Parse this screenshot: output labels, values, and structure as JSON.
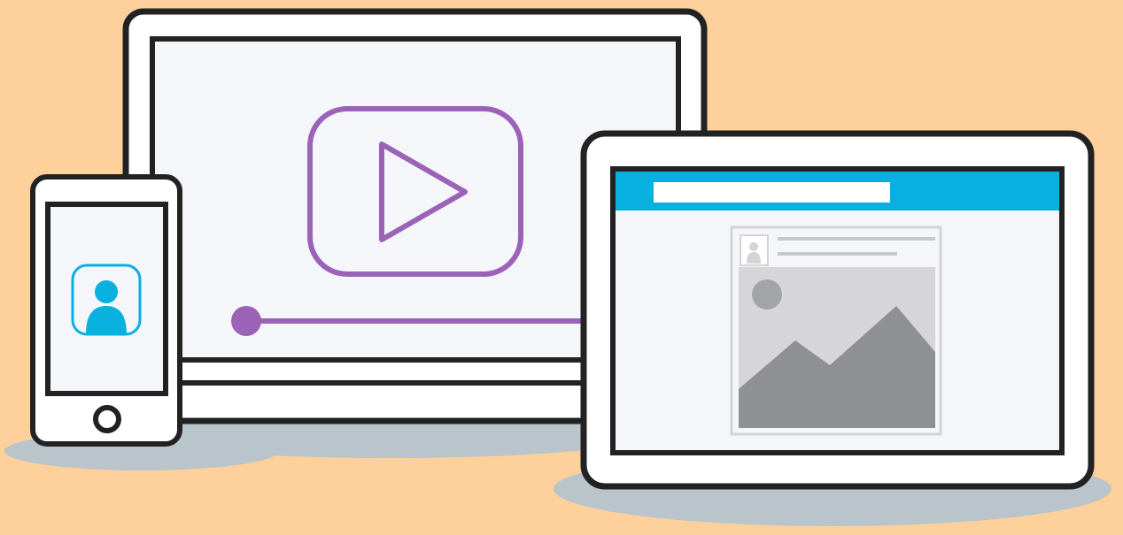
{
  "colors": {
    "background": "#FDD09C",
    "shadow": "#B9C4CB",
    "device_outline": "#222222",
    "device_body": "#FFFFFF",
    "screen": "#F4F6FA",
    "video_accent": "#9B63B8",
    "profile_accent": "#08B0E0",
    "header_bar": "#08B0E0",
    "card_border": "#D4D4D6",
    "card_fill": "#E6E6E8",
    "image_placeholder": "#D6D6D8",
    "mountain": "#8F9092",
    "sun": "#A3A4A6",
    "text_line": "#C8C8CA"
  },
  "devices": {
    "monitor": {
      "name": "monitor",
      "play_icon": "play-button-icon",
      "progress": 0.0
    },
    "phone": {
      "name": "smartphone",
      "screen_icon": "user-profile-icon",
      "home_button_icon": "home-button-icon"
    },
    "tablet": {
      "name": "tablet",
      "post_avatar_icon": "user-avatar-icon",
      "post_image_icon": "image-placeholder-icon"
    }
  }
}
